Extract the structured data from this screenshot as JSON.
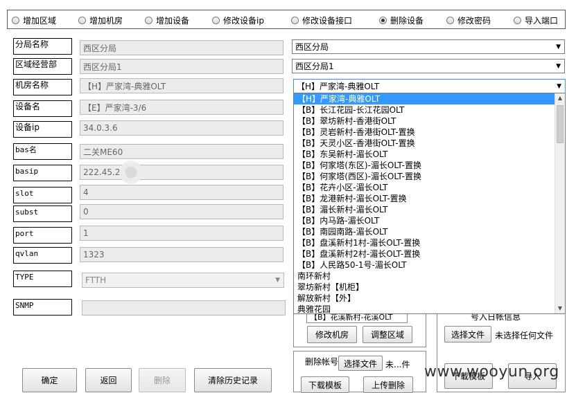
{
  "radios": [
    {
      "label": "增加区域",
      "checked": false
    },
    {
      "label": "增加机房",
      "checked": false
    },
    {
      "label": "增加设备",
      "checked": false
    },
    {
      "label": "修改设备ip",
      "checked": false
    },
    {
      "label": "修改设备接口",
      "checked": false
    },
    {
      "label": "删除设备",
      "checked": true
    },
    {
      "label": "修改密码",
      "checked": false
    },
    {
      "label": "导入端口",
      "checked": false
    }
  ],
  "form": {
    "branch": {
      "label": "分局名称",
      "value": "西区分局"
    },
    "region": {
      "label": "区域经营部",
      "value": "西区分局1"
    },
    "room": {
      "label": "机房名称",
      "value": "【H】严家湾-典雅OLT"
    },
    "device": {
      "label": "设备名",
      "value": "【E】严家湾-3/6"
    },
    "device_ip": {
      "label": "设备ip",
      "value": "34.0.3.6"
    },
    "bas_name": {
      "label": "bas名",
      "value": "二关ME60"
    },
    "basip": {
      "label": "basip",
      "value": "222.45.2."
    },
    "slot": {
      "label": "slot",
      "value": "4"
    },
    "subst": {
      "label": "subst",
      "value": "0"
    },
    "port": {
      "label": "port",
      "value": "1"
    },
    "qvlan": {
      "label": "qvlan",
      "value": "1323"
    },
    "type": {
      "label": "TYPE",
      "value": "FTTH"
    },
    "snmp": {
      "label": "SNMP",
      "value": ""
    }
  },
  "selects": {
    "branch": "西区分局",
    "region": "西区分局1",
    "room": "【H】严家湾-典雅OLT"
  },
  "dropdown": {
    "items": [
      "【H】严家湾-典雅OLT",
      "【B】长江花园-长江花园OLT",
      "【B】翠坊新村-香港街OLT",
      "【B】灵岩新村-香港街OLT-置换",
      "【B】天灵小区-香港街OLT-置换",
      "【B】东吴新村-湄长OLT",
      "【B】何家塔(东区)-湄长OLT-置换",
      "【B】何家塔(西区)-湄长OLT-置换",
      "【B】花卉小区-湄长OLT",
      "【B】龙港新村-湄长OLT-置换",
      "【B】湄长新村-湄长OLT",
      "【B】内马路-湄长OLT",
      "【B】南园南路-湄长OLT",
      "【B】盘溪新村1村-湄长OLT-置换",
      "【B】盘溪新村2村-湄长OLT-置换",
      "【B】人民路50-1号-湄长OLT",
      "南环新村",
      "翠坊新村【机柜】",
      "解放新村【外】",
      "典雅花园"
    ],
    "highlighted_index": 0
  },
  "lower_right": {
    "partial_text": "【B】花溪新村-花溪OLT",
    "edit_room_button": "修改机房",
    "adjust_region_button": "调整区域",
    "partial_right_text": "号入日帐信息",
    "choose_file_button": "选择文件",
    "no_file_text": "未选择任何文件",
    "download_template_button_right": "下载模板",
    "import_button": "导入",
    "delete_account_label": "删除帐号",
    "choose_file_button_2": "选择文件",
    "file_status_2": "未...件",
    "download_template_button": "下载模板",
    "upload_delete_button": "上传删除"
  },
  "bottom_buttons": {
    "confirm": "确定",
    "back": "返回",
    "delete": "删除",
    "clear_history": "清除历史记录"
  },
  "watermark": "www.wooyun.org"
}
